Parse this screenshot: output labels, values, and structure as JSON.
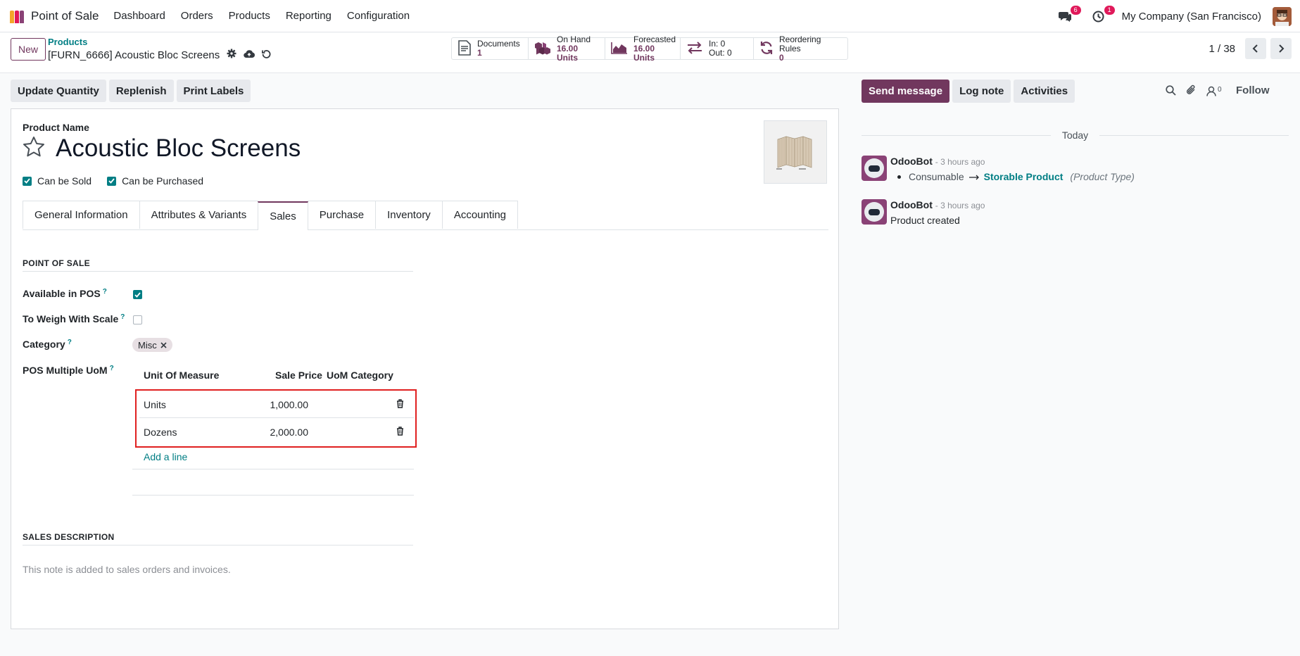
{
  "navbar": {
    "app_name": "Point of Sale",
    "menu": [
      "Dashboard",
      "Orders",
      "Products",
      "Reporting",
      "Configuration"
    ],
    "messages_count": "6",
    "activities_count": "1",
    "company": "My Company (San Francisco)"
  },
  "control": {
    "new_label": "New",
    "breadcrumb_parent": "Products",
    "breadcrumb_current": "[FURN_6666] Acoustic Bloc Screens",
    "smart_buttons": [
      {
        "label": "Documents",
        "value": "1",
        "icon": "document-icon"
      },
      {
        "label": "On Hand",
        "value": "16.00 Units",
        "icon": "cubes-icon"
      },
      {
        "label": "Forecasted",
        "value": "16.00 Units",
        "icon": "area-chart-icon"
      },
      {
        "label": "In: 0",
        "value": "Out: 0",
        "icon": "exchange-icon"
      },
      {
        "label": "Reordering Rules",
        "value": "0",
        "icon": "refresh-icon"
      }
    ],
    "pager": "1 / 38"
  },
  "actions": [
    "Update Quantity",
    "Replenish",
    "Print Labels"
  ],
  "form": {
    "product_name_label": "Product Name",
    "product_name": "Acoustic Bloc Screens",
    "can_be_sold": "Can be Sold",
    "can_be_purchased": "Can be Purchased",
    "tabs": [
      "General Information",
      "Attributes & Variants",
      "Sales",
      "Purchase",
      "Inventory",
      "Accounting"
    ],
    "active_tab": "Sales",
    "pos_section": "POINT OF SALE",
    "available_in_pos": "Available in POS",
    "to_weigh": "To Weigh With Scale",
    "category_label": "Category",
    "category_tag": "Misc",
    "multi_uom_label": "POS Multiple UoM",
    "help_mark": "?",
    "uom_columns": [
      "Unit Of Measure",
      "Sale Price",
      "UoM Category"
    ],
    "uom_rows": [
      {
        "unit": "Units",
        "price": "1,000.00"
      },
      {
        "unit": "Dozens",
        "price": "2,000.00"
      }
    ],
    "add_line": "Add a line",
    "sales_desc_section": "SALES DESCRIPTION",
    "sales_desc_placeholder": "This note is added to sales orders and invoices."
  },
  "chatter": {
    "send_message": "Send message",
    "log_note": "Log note",
    "activities": "Activities",
    "followers_count": "0",
    "follow": "Follow",
    "today": "Today",
    "messages": [
      {
        "author": "OdooBot",
        "time": "- 3 hours ago",
        "old": "Consumable",
        "new": "Storable Product",
        "field": "(Product Type)"
      },
      {
        "author": "OdooBot",
        "time": "- 3 hours ago",
        "text": "Product created"
      }
    ]
  },
  "colors": {
    "brand": "#71375e",
    "link": "#017e84",
    "highlight": "#e02020"
  }
}
